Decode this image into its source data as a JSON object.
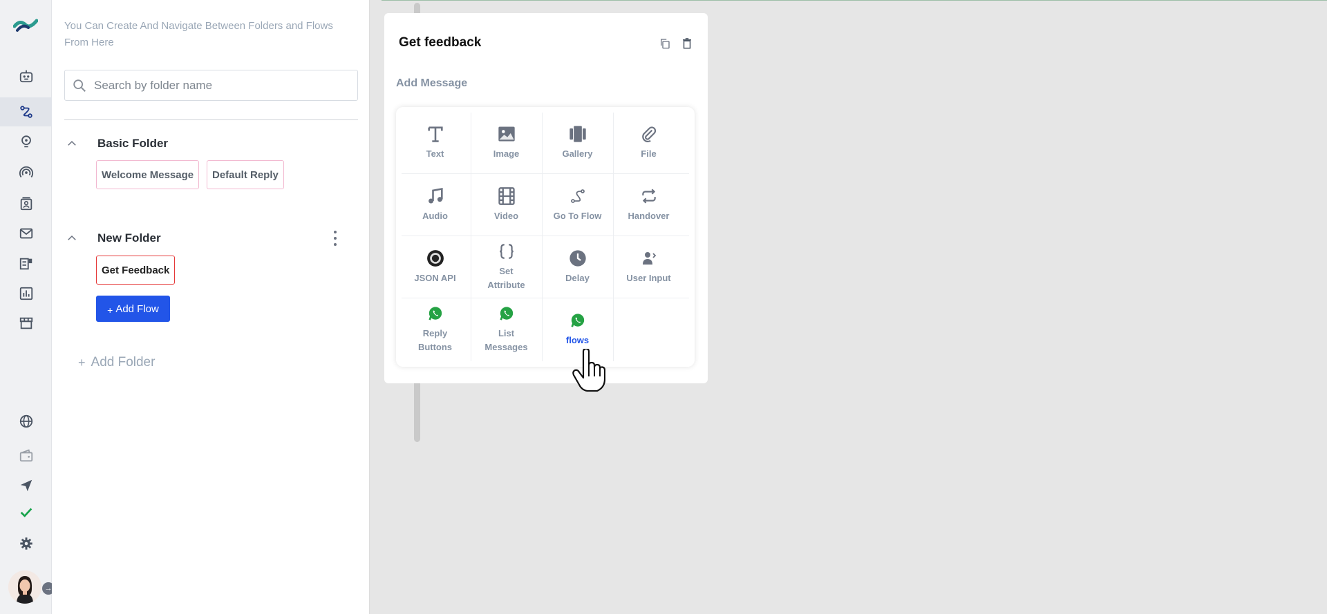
{
  "sidebar": {
    "icons": [
      "logo-icon",
      "bot-icon",
      "flows-icon",
      "bulb-icon",
      "broadcast-icon",
      "contacts-icon",
      "mail-icon",
      "template-icon",
      "analytics-icon",
      "store-icon",
      "globe-icon",
      "wallet-icon",
      "send-icon",
      "check-icon",
      "gear-icon"
    ],
    "active": "flows-icon",
    "expand_label": "→"
  },
  "panel": {
    "hint": "You Can Create And Navigate Between Folders and Flows From Here",
    "search_placeholder": "Search by folder name",
    "folders": [
      {
        "name": "Basic Folder",
        "flows": [
          "Welcome Message",
          "Default Reply"
        ]
      },
      {
        "name": "New Folder",
        "flows": [
          "Get Feedback"
        ],
        "selected_flow": "Get Feedback"
      }
    ],
    "add_flow_label": "Add Flow",
    "add_flow_plus": "+",
    "add_folder_label": "Add Folder",
    "add_folder_plus": "+"
  },
  "card": {
    "title": "Get feedback",
    "subtitle": "Add Message",
    "items": [
      {
        "label": "Text",
        "icon": "text-icon"
      },
      {
        "label": "Image",
        "icon": "image-icon"
      },
      {
        "label": "Gallery",
        "icon": "gallery-icon"
      },
      {
        "label": "File",
        "icon": "paperclip-icon"
      },
      {
        "label": "Audio",
        "icon": "music-icon"
      },
      {
        "label": "Video",
        "icon": "film-icon"
      },
      {
        "label": "Go To Flow",
        "icon": "route-icon"
      },
      {
        "label": "Handover",
        "icon": "repeat-icon"
      },
      {
        "label": "JSON API",
        "icon": "api-icon"
      },
      {
        "label": "Set Attribute",
        "icon": "braces-icon"
      },
      {
        "label": "Delay",
        "icon": "clock-icon"
      },
      {
        "label": "User Input",
        "icon": "user-input-icon"
      },
      {
        "label": "Reply Buttons",
        "icon": "whatsapp-icon"
      },
      {
        "label": "List Messages",
        "icon": "whatsapp-icon"
      },
      {
        "label": "flows",
        "icon": "whatsapp-icon"
      }
    ]
  },
  "colors": {
    "accent": "#2255e8",
    "selected_border": "#e53939",
    "chip_border": "#f2b8d0",
    "whatsapp": "#25a244"
  }
}
